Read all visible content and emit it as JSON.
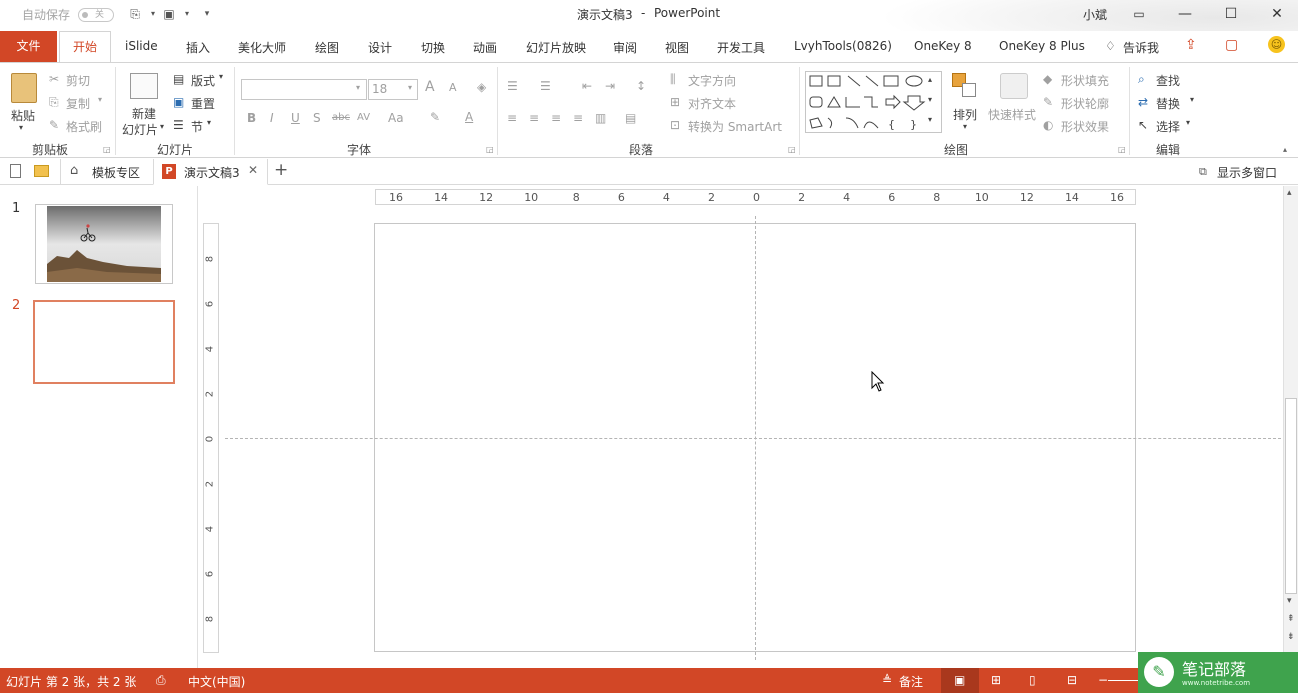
{
  "titlebar": {
    "autosave_label": "自动保存",
    "autosave_state": "关",
    "doc_title": "演示文稿3",
    "dash": "-",
    "app_name": "PowerPoint",
    "user": "小斌"
  },
  "tabs": {
    "file": "文件",
    "home": "开始",
    "items": [
      "iSlide",
      "插入",
      "美化大师",
      "绘图",
      "设计",
      "切换",
      "动画",
      "幻灯片放映",
      "审阅",
      "视图",
      "开发工具",
      "LvyhTools(0826)",
      "OneKey 8",
      "OneKey 8 Plus"
    ],
    "tell_me": "告诉我"
  },
  "ribbon": {
    "clipboard": {
      "paste": "粘贴",
      "cut": "剪切",
      "copy": "复制",
      "format_painter": "格式刷",
      "label": "剪贴板"
    },
    "slides": {
      "new_slide_line1": "新建",
      "new_slide_line2": "幻灯片",
      "layout": "版式",
      "reset": "重置",
      "section": "节",
      "label": "幻灯片"
    },
    "font": {
      "size": "18",
      "bold": "B",
      "italic": "I",
      "underline": "U",
      "shadow": "S",
      "strike": "abc",
      "spacing": "AV",
      "case": "Aa",
      "grow": "A",
      "shrink": "A",
      "color": "A",
      "label": "字体"
    },
    "paragraph": {
      "text_direction": "文字方向",
      "align_text": "对齐文本",
      "smartart": "转换为 SmartArt",
      "label": "段落"
    },
    "drawing": {
      "arrange": "排列",
      "quick_styles": "快速样式",
      "shape_fill": "形状填充",
      "shape_outline": "形状轮廓",
      "shape_effects": "形状效果",
      "label": "绘图"
    },
    "editing": {
      "find": "查找",
      "replace": "替换",
      "select": "选择",
      "label": "编辑"
    }
  },
  "doctabs": {
    "templates": "模板专区",
    "doc": "演示文稿3",
    "add": "+",
    "multi_window": "显示多窗口"
  },
  "thumbnails": [
    {
      "num": "1"
    },
    {
      "num": "2"
    }
  ],
  "ruler_h": [
    "16",
    "14",
    "12",
    "10",
    "8",
    "6",
    "4",
    "2",
    "0",
    "2",
    "4",
    "6",
    "8",
    "10",
    "12",
    "14",
    "16"
  ],
  "ruler_v": [
    "8",
    "6",
    "4",
    "2",
    "0",
    "2",
    "4",
    "6",
    "8"
  ],
  "status": {
    "slide_info": "幻灯片 第 2 张，共 2 张",
    "language": "中文(中国)",
    "notes": "备注"
  },
  "watermark": {
    "text": "笔记部落",
    "url": "www.notetribe.com"
  },
  "colors": {
    "accent": "#d24726",
    "watermark": "#3fa34d"
  }
}
